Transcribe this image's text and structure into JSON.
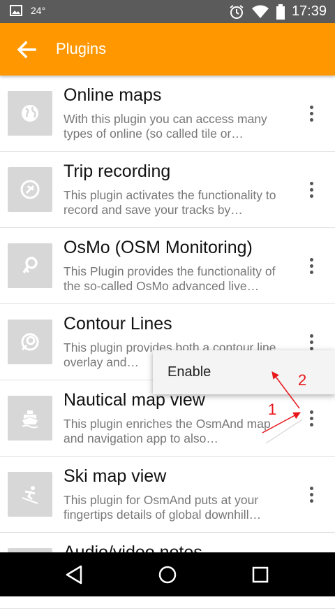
{
  "status_bar": {
    "temperature": "24°",
    "time": "17:39",
    "icons": [
      "image-icon",
      "alarm-icon",
      "wifi-icon",
      "battery-icon"
    ]
  },
  "app_bar": {
    "title": "Plugins",
    "background": "#ff9800"
  },
  "plugins": [
    {
      "name": "Online maps",
      "description": "With this plugin you can access many types of online (so called tile or…",
      "icon": "globe-icon"
    },
    {
      "name": "Trip recording",
      "description": "This plugin activates the functionality to record and save your tracks by…",
      "icon": "trip-recording-icon"
    },
    {
      "name": "OsMo (OSM Monitoring)",
      "description": "This Plugin provides the functionality of the so-called OsMo advanced live…",
      "icon": "osmo-icon"
    },
    {
      "name": "Contour Lines",
      "description": "This plugin provides both a contour line overlay and…",
      "icon": "contour-icon"
    },
    {
      "name": "Nautical map view",
      "description": "This plugin enriches the OsmAnd map and navigation app to also…",
      "icon": "ship-icon"
    },
    {
      "name": "Ski map view",
      "description": "This plugin for OsmAnd puts at your fingertips details of global downhill…",
      "icon": "skier-icon"
    },
    {
      "name": "Audio/video notes",
      "description": "",
      "icon": "audio-video-icon"
    }
  ],
  "popup_menu": {
    "item": "Enable"
  },
  "annotations": {
    "step1": "1",
    "step2": "2",
    "color": "#e8151b"
  }
}
